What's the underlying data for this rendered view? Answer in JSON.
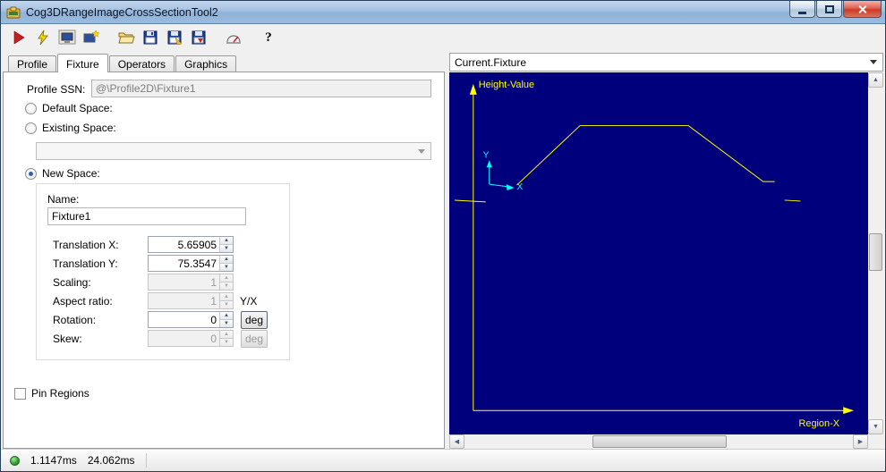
{
  "window": {
    "title": "Cog3DRangeImageCrossSectionTool2"
  },
  "toolbar": {
    "buttons": [
      "run",
      "live-run",
      "show-display",
      "add-display",
      "open-file",
      "save",
      "save-as",
      "save-results",
      "benchmark",
      "help"
    ],
    "help_glyph": "?"
  },
  "tabs": {
    "items": [
      {
        "label": "Profile",
        "active": false
      },
      {
        "label": "Fixture",
        "active": true
      },
      {
        "label": "Operators",
        "active": false
      },
      {
        "label": "Graphics",
        "active": false
      }
    ]
  },
  "fixture": {
    "profile_ssn_label": "Profile SSN:",
    "profile_ssn_value": "@\\Profile2D\\Fixture1",
    "default_space_label": "Default Space:",
    "existing_space_label": "Existing Space:",
    "existing_space_value": "",
    "new_space_label": "New Space:",
    "name_label": "Name:",
    "name_value": "Fixture1",
    "fields": [
      {
        "label": "Translation X:",
        "value": "5.65905",
        "enabled": true
      },
      {
        "label": "Translation Y:",
        "value": "75.3547",
        "enabled": true
      },
      {
        "label": "Scaling:",
        "value": "1",
        "enabled": false
      },
      {
        "label": "Aspect ratio:",
        "value": "1",
        "enabled": false,
        "suffix": "Y/X"
      },
      {
        "label": "Rotation:",
        "value": "0",
        "enabled": true,
        "button": "deg"
      },
      {
        "label": "Skew:",
        "value": "0",
        "enabled": false,
        "button": "deg"
      }
    ],
    "pin_regions_label": "Pin Regions"
  },
  "display": {
    "selector_value": "Current.Fixture",
    "height_axis_label": "Height-Value",
    "region_axis_label": "Region-X",
    "mini_axes": {
      "y": "Y",
      "x": "X"
    },
    "colors": {
      "background": "#00007d",
      "axes": "#ffff00",
      "profile": "#ffff00",
      "mini_axes": "#00ffff"
    }
  },
  "statusbar": {
    "time1": "1.1147ms",
    "time2": "24.062ms"
  }
}
